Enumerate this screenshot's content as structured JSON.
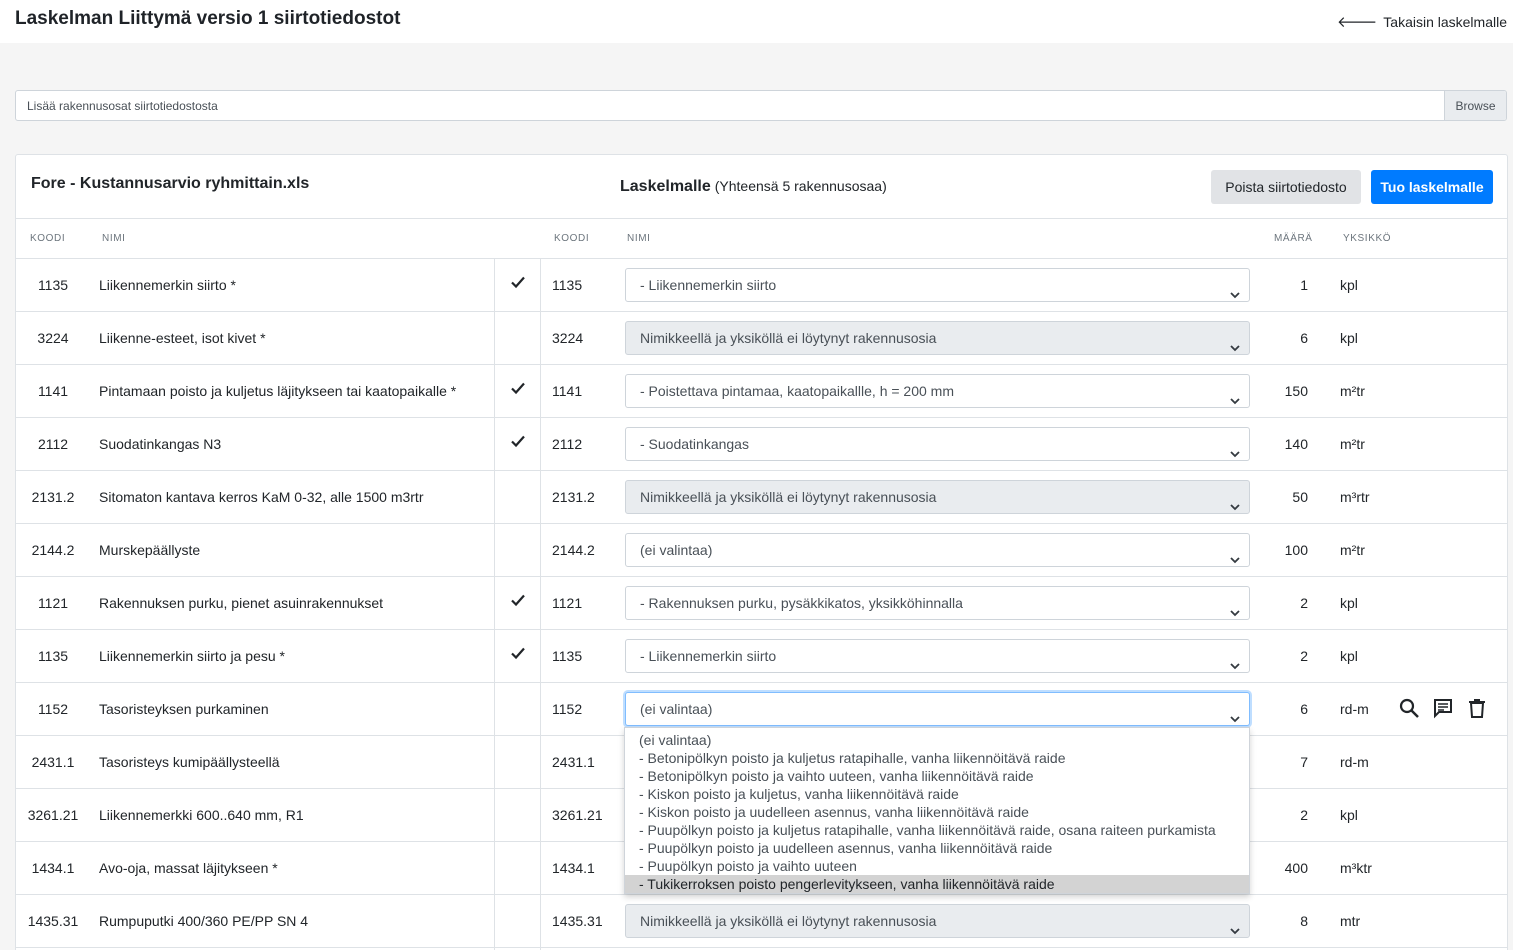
{
  "header": {
    "title": "Laskelman Liittymä versio 1 siirtotiedostot",
    "back_label": "Takaisin laskelmalle"
  },
  "upload": {
    "placeholder": "Lisää rakennusosat siirtotiedostosta",
    "browse_label": "Browse"
  },
  "card": {
    "file_name": "Fore - Kustannusarvio ryhmittain.xls",
    "laskelma_title": "Laskelmalle",
    "laskelma_count": "(Yhteensä 5 rakennusosaa)",
    "delete_label": "Poista siirtotiedosto",
    "import_label": "Tuo laskelmalle"
  },
  "columns": {
    "left_code": "KOODI",
    "left_name": "NIMI",
    "right_code": "KOODI",
    "right_name": "NIMI",
    "qty": "MÄÄRÄ",
    "unit": "YKSIKKÖ"
  },
  "rows": [
    {
      "code": "1135",
      "name": "Liikennemerkin siirto *",
      "checked": true,
      "rcode": "1135",
      "select": "- Liikennemerkin siirto",
      "disabled": false,
      "qty": "1",
      "unit": "kpl"
    },
    {
      "code": "3224",
      "name": "Liikenne-esteet, isot kivet *",
      "checked": false,
      "rcode": "3224",
      "select": "Nimikkeellä ja yksiköllä ei löytynyt rakennusosia",
      "disabled": true,
      "qty": "6",
      "unit": "kpl"
    },
    {
      "code": "1141",
      "name": "Pintamaan poisto ja kuljetus läjitykseen tai kaatopaikalle *",
      "checked": true,
      "rcode": "1141",
      "select": "- Poistettava pintamaa, kaatopaikallle, h = 200 mm",
      "disabled": false,
      "qty": "150",
      "unit": "m²tr"
    },
    {
      "code": "2112",
      "name": "Suodatinkangas N3",
      "checked": true,
      "rcode": "2112",
      "select": "- Suodatinkangas",
      "disabled": false,
      "qty": "140",
      "unit": "m²tr"
    },
    {
      "code": "2131.2",
      "name": "Sitomaton kantava kerros KaM 0-32, alle 1500 m3rtr",
      "checked": false,
      "rcode": "2131.2",
      "select": "Nimikkeellä ja yksiköllä ei löytynyt rakennusosia",
      "disabled": true,
      "qty": "50",
      "unit": "m³rtr"
    },
    {
      "code": "2144.2",
      "name": "Murskepäällyste",
      "checked": false,
      "rcode": "2144.2",
      "select": "(ei valintaa)",
      "disabled": false,
      "qty": "100",
      "unit": "m²tr"
    },
    {
      "code": "1121",
      "name": "Rakennuksen purku, pienet asuinrakennukset",
      "checked": true,
      "rcode": "1121",
      "select": "- Rakennuksen purku, pysäkkikatos, yksikköhinnalla",
      "disabled": false,
      "qty": "2",
      "unit": "kpl"
    },
    {
      "code": "1135",
      "name": "Liikennemerkin siirto ja pesu *",
      "checked": true,
      "rcode": "1135",
      "select": "- Liikennemerkin siirto",
      "disabled": false,
      "qty": "2",
      "unit": "kpl"
    },
    {
      "code": "1152",
      "name": "Tasoristeyksen purkaminen",
      "checked": false,
      "rcode": "1152",
      "select": "(ei valintaa)",
      "disabled": false,
      "focused": true,
      "qty": "6",
      "unit": "rd-m",
      "actions": true
    },
    {
      "code": "2431.1",
      "name": "Tasoristeys kumipäällysteellä",
      "checked": false,
      "rcode": "2431.1",
      "select": "",
      "disabled": false,
      "qty": "7",
      "unit": "rd-m"
    },
    {
      "code": "3261.21",
      "name": "Liikennemerkki 600..640 mm, R1",
      "checked": false,
      "rcode": "3261.21",
      "select": "",
      "disabled": false,
      "qty": "2",
      "unit": "kpl"
    },
    {
      "code": "1434.1",
      "name": "Avo-oja, massat läjitykseen *",
      "checked": false,
      "rcode": "1434.1",
      "select": "",
      "disabled": false,
      "qty": "400",
      "unit": "m³ktr"
    },
    {
      "code": "1435.31",
      "name": "Rumpuputki 400/360 PE/PP SN 4",
      "checked": false,
      "rcode": "1435.31",
      "select": "Nimikkeellä ja yksiköllä ei löytynyt rakennusosia",
      "disabled": true,
      "qty": "8",
      "unit": "mtr"
    }
  ],
  "dropdown_options": [
    "(ei valintaa)",
    "- Betonipölkyn poisto ja kuljetus ratapihalle, vanha liikennöitävä raide",
    "- Betonipölkyn poisto ja vaihto uuteen, vanha liikennöitävä raide",
    "- Kiskon poisto ja kuljetus, vanha liikennöitävä raide",
    "- Kiskon poisto ja uudelleen asennus, vanha liikennöitävä raide",
    "- Puupölkyn poisto ja kuljetus ratapihalle, vanha liikennöitävä raide, osana raiteen purkamista",
    "- Puupölkyn poisto ja uudelleen asennus, vanha liikennöitävä raide",
    "- Puupölkyn poisto ja vaihto uuteen",
    "- Tukikerroksen poisto pengerlevitykseen, vanha liikennöitävä raide"
  ],
  "dropdown_highlighted_index": 8,
  "icons": {
    "back": "arrow-left-icon",
    "check": "check-icon",
    "chevron": "chevron-down-icon",
    "search": "search-icon",
    "comment": "comment-icon",
    "delete": "trash-icon"
  },
  "colors": {
    "primary": "#007bff",
    "secondary_button": "#e1e3e6",
    "disabled_select": "#e9ecef",
    "highlight_option": "#d3d3d3"
  }
}
